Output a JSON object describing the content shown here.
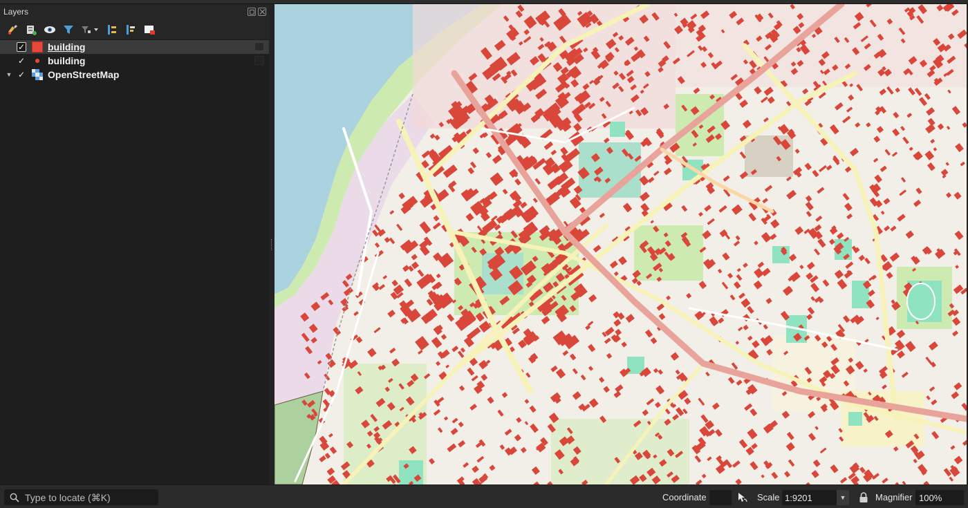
{
  "layers_panel": {
    "title": "Layers",
    "toolbar": [
      {
        "name": "open-layer-styling-icon"
      },
      {
        "name": "add-group-icon"
      },
      {
        "name": "manage-map-themes-icon"
      },
      {
        "name": "filter-legend-icon"
      },
      {
        "name": "filter-by-expression-icon"
      },
      {
        "name": "expand-all-icon"
      },
      {
        "name": "collapse-all-icon"
      },
      {
        "name": "remove-layer-icon"
      }
    ],
    "layers": [
      {
        "name": "building",
        "checked": true,
        "symbol": "fill",
        "color": "#e8483a",
        "selected": true
      },
      {
        "name": "building",
        "checked": true,
        "symbol": "point",
        "color": "#e84a3a",
        "selected": false
      },
      {
        "name": "OpenStreetMap",
        "checked": true,
        "symbol": "raster",
        "expanded": true
      }
    ],
    "check_glyph": "✓",
    "expand_glyph": "▼"
  },
  "map": {
    "building_color": "#d9473a",
    "water_color": "#aad3df",
    "road_major_color": "#e8a39a",
    "road_secondary_color": "#f7f2b8",
    "park_color": "#cdebb0",
    "pitch_color": "#8fe3c0",
    "background_color": "#f2efe9"
  },
  "status_bar": {
    "locator_placeholder": "Type to locate (⌘K)",
    "coordinate_label": "Coordinate",
    "coordinate_value": "",
    "scale_label": "Scale",
    "scale_value": "1:9201",
    "magnifier_label": "Magnifier",
    "magnifier_value": "100%"
  }
}
